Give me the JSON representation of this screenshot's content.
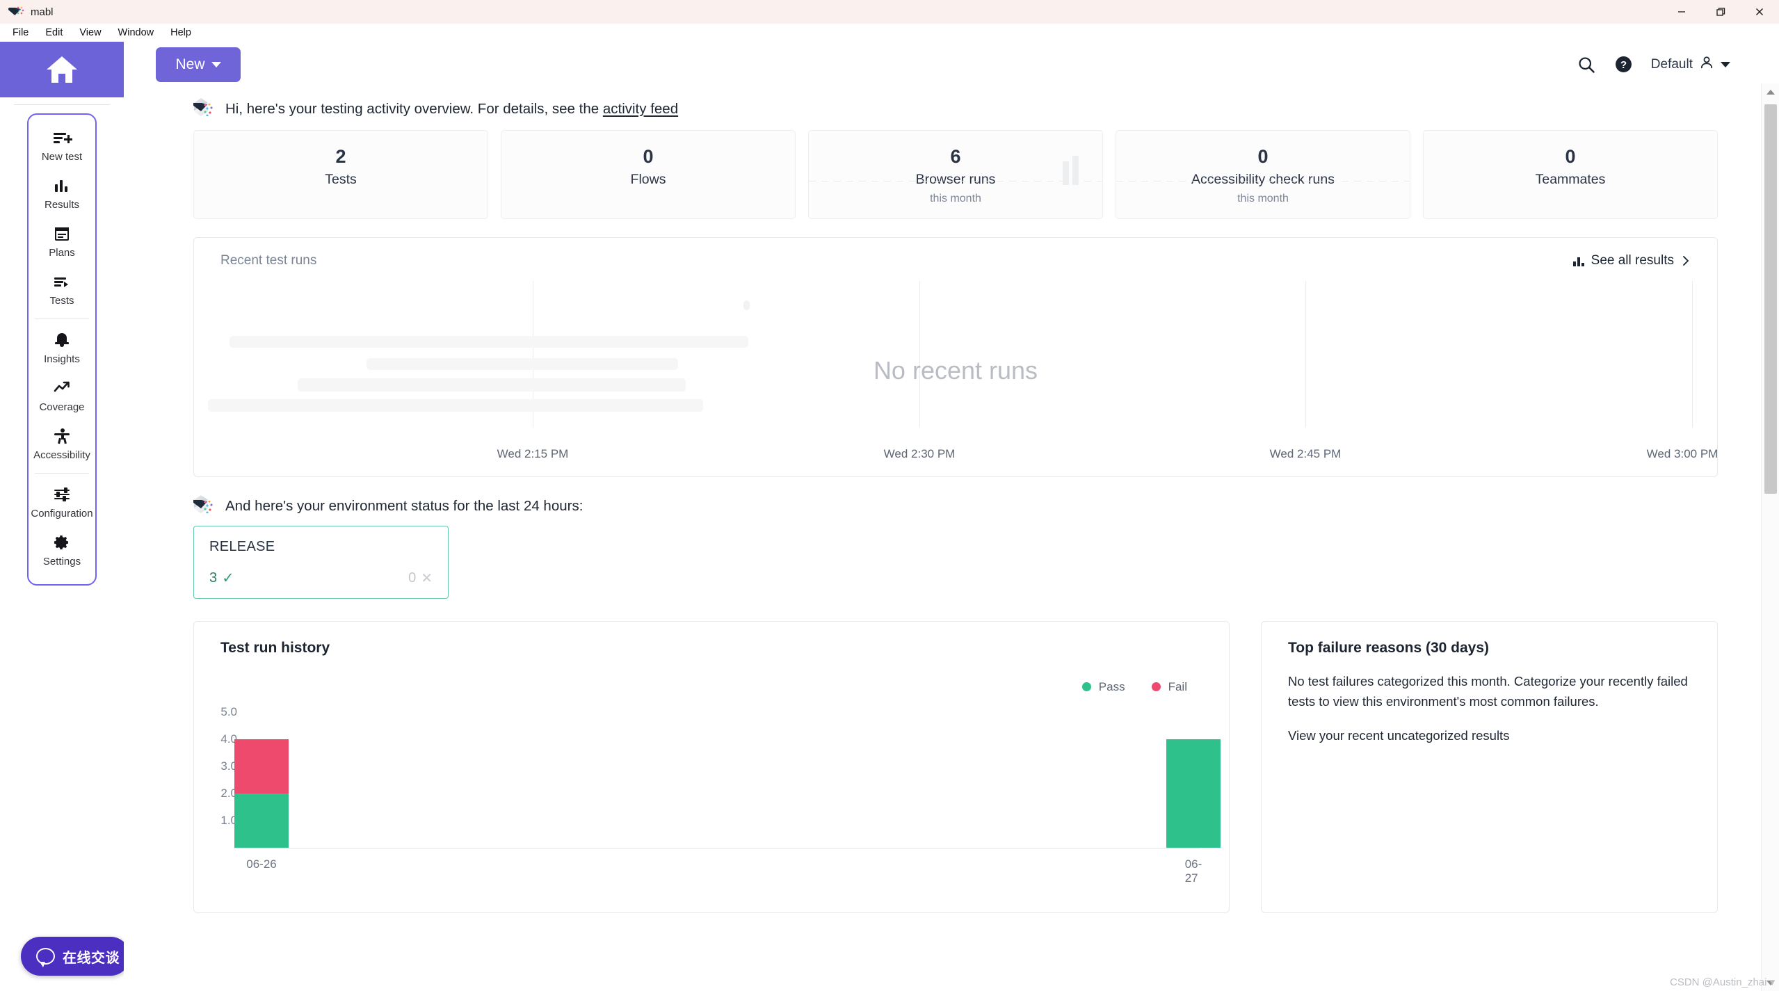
{
  "window": {
    "title": "mabl",
    "minimize": "—",
    "maximize": "❐",
    "close": "✕"
  },
  "menubar": {
    "items": [
      "File",
      "Edit",
      "View",
      "Window",
      "Help"
    ]
  },
  "sidebar": {
    "home_label": "home-icon",
    "items": [
      {
        "label": "New test",
        "icon": "new-test-icon"
      },
      {
        "label": "Results",
        "icon": "results-bar-chart-icon"
      },
      {
        "label": "Plans",
        "icon": "plans-calendar-icon"
      },
      {
        "label": "Tests",
        "icon": "tests-list-play-icon"
      },
      {
        "label": "Insights",
        "icon": "insights-bell-icon"
      },
      {
        "label": "Coverage",
        "icon": "coverage-trend-icon"
      },
      {
        "label": "Accessibility",
        "icon": "accessibility-person-icon"
      },
      {
        "label": "Configuration",
        "icon": "configuration-sliders-icon"
      },
      {
        "label": "Settings",
        "icon": "settings-gear-icon"
      }
    ],
    "chat_label": "在线交谈"
  },
  "topbar": {
    "new_button": "New",
    "account_name": "Default",
    "search_icon": "search-icon",
    "help_icon": "help-circle-icon"
  },
  "greeting": {
    "text_before": "Hi, here's your testing activity overview. For details, see the ",
    "link": "activity feed"
  },
  "stats": [
    {
      "value": "2",
      "label": "Tests",
      "sub": ""
    },
    {
      "value": "0",
      "label": "Flows",
      "sub": ""
    },
    {
      "value": "6",
      "label": "Browser runs",
      "sub": "this month"
    },
    {
      "value": "0",
      "label": "Accessibility check runs",
      "sub": "this month"
    },
    {
      "value": "0",
      "label": "Teammates",
      "sub": ""
    }
  ],
  "recent_runs": {
    "title": "Recent test runs",
    "see_all": "See all results",
    "empty_text": "No recent runs",
    "xticks": [
      "Wed 2:15 PM",
      "Wed 2:30 PM",
      "Wed 2:45 PM",
      "Wed 3:00 PM"
    ]
  },
  "environment": {
    "heading": "And here's your environment status for the last 24 hours:",
    "card": {
      "name": "RELEASE",
      "pass_count": "3",
      "fail_count": "0",
      "pass_icon": "check-icon",
      "fail_icon": "x-icon",
      "border_color": "#66c8a6"
    }
  },
  "failures": {
    "title": "Top failure reasons (30 days)",
    "body": "No test failures categorized this month. Categorize your recently failed tests to view this environment's most common failures.",
    "link": "View your recent uncategorized results"
  },
  "watermark": "CSDN @Austin_zhai",
  "chart_data": {
    "type": "bar",
    "stacked": true,
    "title": "Test run history",
    "categories": [
      "06-26",
      "06-27"
    ],
    "series": [
      {
        "name": "Pass",
        "color": "#2fc18c",
        "values": [
          2,
          4
        ]
      },
      {
        "name": "Fail",
        "color": "#ed4a6e",
        "values": [
          2,
          0
        ]
      }
    ],
    "legend": [
      "Pass",
      "Fail"
    ],
    "legend_position": "top-right",
    "yticks": [
      "1.0",
      "2.0",
      "3.0",
      "4.0",
      "5.0"
    ],
    "ylim": [
      0,
      5
    ],
    "xlabel": "",
    "ylabel": "",
    "grid": false
  }
}
